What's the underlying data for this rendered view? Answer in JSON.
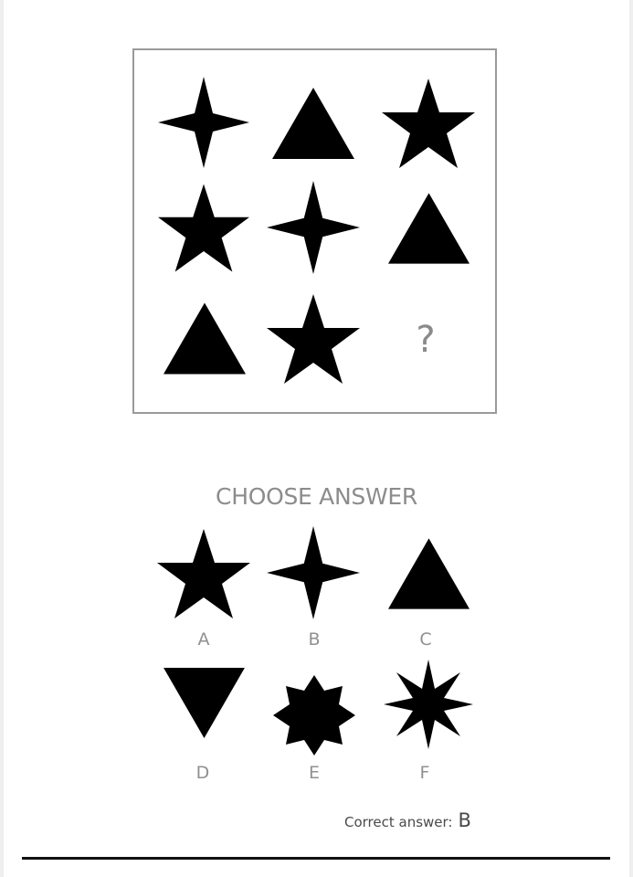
{
  "puzzle": {
    "cells": [
      {
        "shape": "four-point-star"
      },
      {
        "shape": "triangle"
      },
      {
        "shape": "five-point-star"
      },
      {
        "shape": "five-point-star"
      },
      {
        "shape": "four-point-star"
      },
      {
        "shape": "triangle"
      },
      {
        "shape": "triangle"
      },
      {
        "shape": "five-point-star"
      },
      {
        "shape": "unknown"
      }
    ],
    "question_mark": "?"
  },
  "choices": {
    "title": "CHOOSE ANSWER",
    "options": [
      {
        "label": "A",
        "shape": "five-point-star"
      },
      {
        "label": "B",
        "shape": "four-point-star"
      },
      {
        "label": "C",
        "shape": "triangle"
      },
      {
        "label": "D",
        "shape": "inverted-triangle"
      },
      {
        "label": "E",
        "shape": "eight-point-star"
      },
      {
        "label": "F",
        "shape": "eight-point-spiky-star"
      }
    ]
  },
  "answer": {
    "prefix": "Correct answer:",
    "value": "B"
  },
  "colors": {
    "shape_fill": "#000000",
    "muted_text": "#8c8c8c",
    "box_border": "#9a9a9a"
  }
}
